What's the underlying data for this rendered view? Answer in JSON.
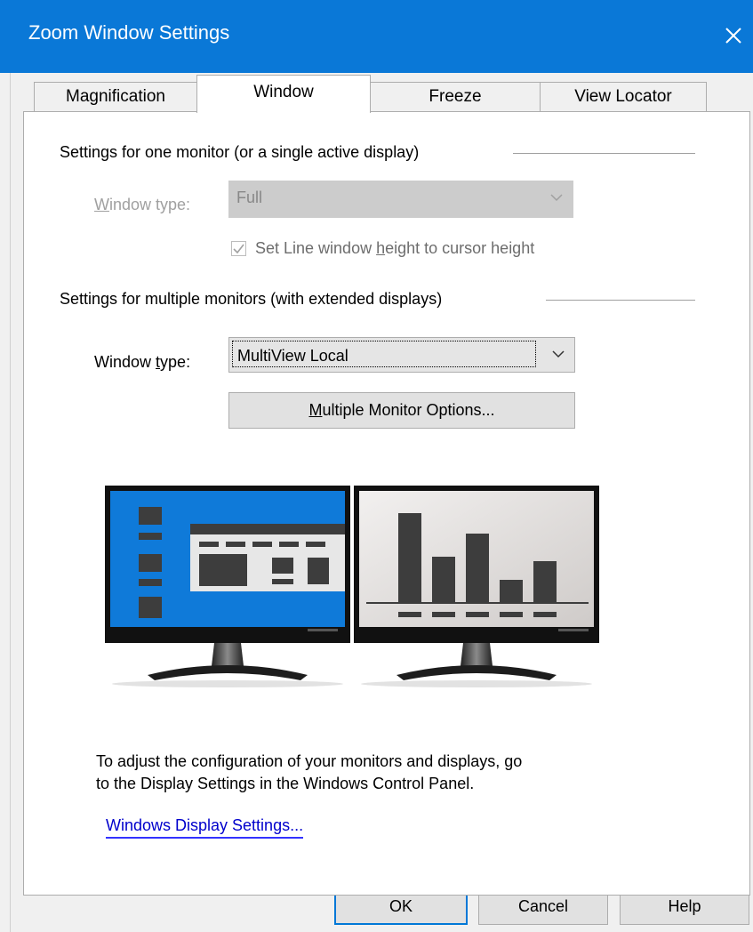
{
  "window": {
    "title": "Zoom Window Settings",
    "close_glyph": "✕"
  },
  "tabs": [
    {
      "label": "Magnification",
      "active": false
    },
    {
      "label": "Window",
      "active": true
    },
    {
      "label": "Freeze",
      "active": false
    },
    {
      "label": "View Locator",
      "active": false
    }
  ],
  "single_monitor": {
    "heading": "Settings for one monitor (or a single active display)",
    "window_type_label": "Window type:",
    "window_type_value": "Full",
    "enabled": false,
    "checkbox_label": "Set Line window height to cursor height",
    "checkbox_checked": true
  },
  "multi_monitor": {
    "heading": "Settings for multiple monitors (with extended displays)",
    "window_type_label": "Window type:",
    "window_type_value": "MultiView Local",
    "options_button": "Multiple Monitor Options..."
  },
  "illustration": {
    "icon": "dual-monitor-illustration",
    "left_screen_color": "#0f7ad9",
    "right_screen_color": "#e4e1e0"
  },
  "info": {
    "line1": "To adjust the configuration of your monitors and displays, go",
    "line2": "to the Display Settings in the Windows Control Panel.",
    "link": "Windows Display Settings..."
  },
  "buttons": {
    "ok": "OK",
    "cancel": "Cancel",
    "help": "Help"
  },
  "colors": {
    "titlebar": "#0a78d7",
    "link": "#0000cc"
  }
}
